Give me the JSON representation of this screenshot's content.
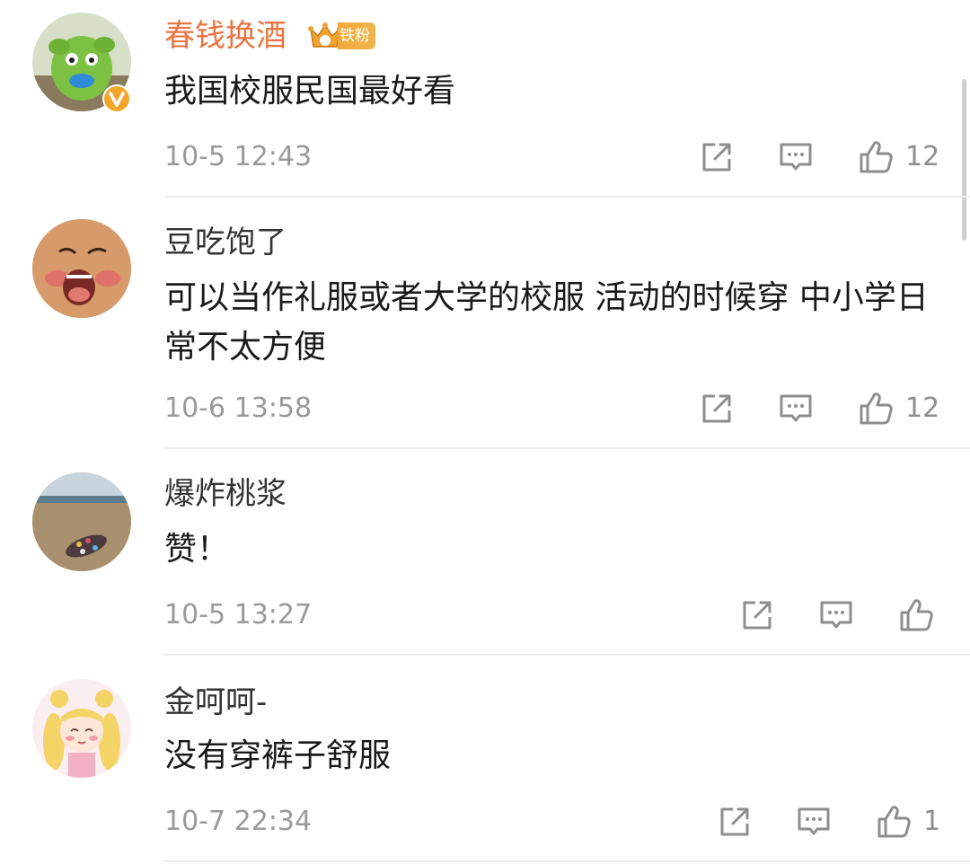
{
  "comments": [
    {
      "username": "春钱换酒",
      "badge": "铁粉",
      "text": "我国校服民国最好看",
      "time": "10-5 12:43",
      "likes": "12"
    },
    {
      "username": "豆吃饱了",
      "text": "可以当作礼服或者大学的校服 活动的时候穿 中小学日常不太方便",
      "time": "10-6 13:58",
      "likes": "12"
    },
    {
      "username": "爆炸桃浆",
      "text": "赞！",
      "time": "10-5 13:27",
      "likes": ""
    },
    {
      "username": "金呵呵-",
      "text": "没有穿裤子舒服",
      "time": "10-7 22:34",
      "likes": "1"
    }
  ],
  "icons": {
    "share": "share-icon",
    "reply": "comment-icon",
    "like": "thumbs-up-icon",
    "verified": "verified-v-icon",
    "crown": "crown-icon"
  },
  "colors": {
    "vip_name": "#eb7340",
    "badge": "#f3a93a",
    "verified": "#f4a62a",
    "meta": "#9a9a9a"
  }
}
